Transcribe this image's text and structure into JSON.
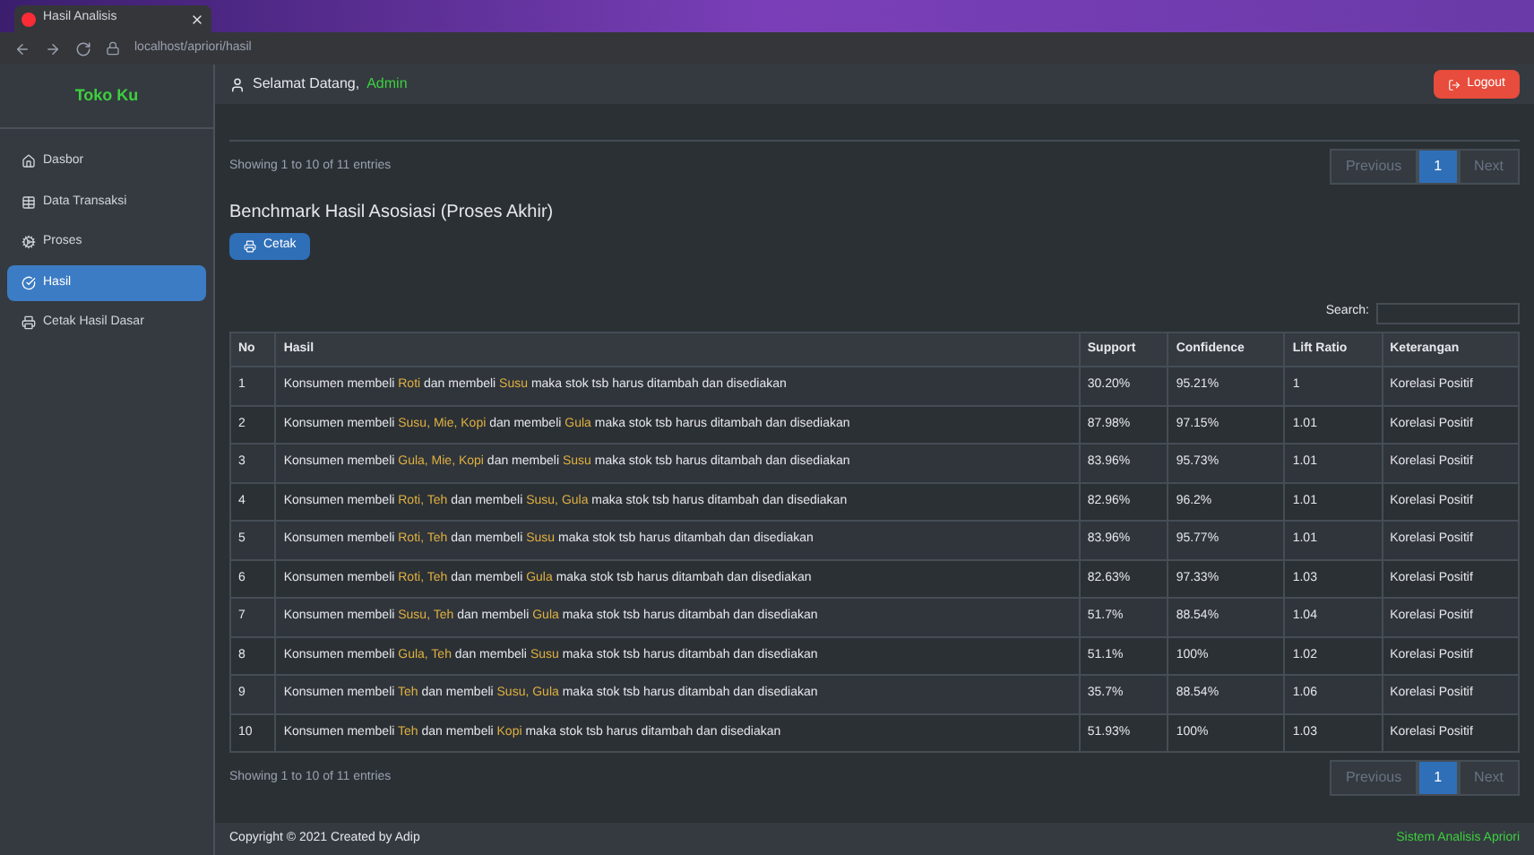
{
  "browser": {
    "tab_title": "Hasil Analisis",
    "address": "localhost/apriori/hasil"
  },
  "sidebar": {
    "logo": "Toko Ku",
    "items": [
      {
        "label": "Dasbor",
        "selected": false
      },
      {
        "label": "Data Transaksi",
        "selected": false
      },
      {
        "label": "Proses",
        "selected": false
      },
      {
        "label": "Hasil",
        "selected": true
      },
      {
        "label": "Cetak Hasil Dasar",
        "selected": false
      }
    ]
  },
  "header": {
    "greeting": "Selamat Datang,",
    "user": "Admin",
    "logout": "Logout"
  },
  "top_info": "Showing 1 to 10 of 11 entries",
  "pagination": [
    {
      "label": "Previous",
      "selected": false
    },
    {
      "label": "1",
      "selected": true
    },
    {
      "label": "Next",
      "selected": false
    }
  ],
  "bottom_pagination": [
    {
      "label": "Previous",
      "selected": false
    },
    {
      "label": "1",
      "selected": true
    },
    {
      "label": "Next",
      "selected": false
    }
  ],
  "section_title": "Benchmark Hasil Asosiasi (Proses Akhir)",
  "print_button": "Cetak",
  "search_label": "Search:",
  "table": {
    "columns": [
      "No",
      "Hasil",
      "Support",
      "Confidence",
      "Lift Ratio",
      "Keterangan"
    ],
    "rows": [
      {
        "no": "1",
        "rule": "Konsumen membeli **Roti** dan membeli **Susu** maka stok tsb harus ditambah dan disediakan",
        "support": "30.20%",
        "confidence": "95.21%",
        "lift": "1",
        "keterangan": "Korelasi Positif"
      },
      {
        "no": "2",
        "rule": "Konsumen membeli **Susu, Mie, Kopi** dan membeli **Gula** maka stok tsb harus ditambah dan disediakan",
        "support": "87.98%",
        "confidence": "97.15%",
        "lift": "1.01",
        "keterangan": "Korelasi Positif"
      },
      {
        "no": "3",
        "rule": "Konsumen membeli **Gula, Mie, Kopi** dan membeli **Susu** maka stok tsb harus ditambah dan disediakan",
        "support": "83.96%",
        "confidence": "95.73%",
        "lift": "1.01",
        "keterangan": "Korelasi Positif"
      },
      {
        "no": "4",
        "rule": "Konsumen membeli **Roti, Teh** dan membeli **Susu, Gula** maka stok tsb harus ditambah dan disediakan",
        "support": "82.96%",
        "confidence": "96.2%",
        "lift": "1.01",
        "keterangan": "Korelasi Positif"
      },
      {
        "no": "5",
        "rule": "Konsumen membeli **Roti, Teh** dan membeli **Susu** maka stok tsb harus ditambah dan disediakan",
        "support": "83.96%",
        "confidence": "95.77%",
        "lift": "1.01",
        "keterangan": "Korelasi Positif"
      },
      {
        "no": "6",
        "rule": "Konsumen membeli **Roti, Teh** dan membeli **Gula** maka stok tsb harus ditambah dan disediakan",
        "support": "82.63%",
        "confidence": "97.33%",
        "lift": "1.03",
        "keterangan": "Korelasi Positif"
      },
      {
        "no": "7",
        "rule": "Konsumen membeli **Susu, Teh** dan membeli **Gula** maka stok tsb harus ditambah dan disediakan",
        "support": "51.7%",
        "confidence": "88.54%",
        "lift": "1.04",
        "keterangan": "Korelasi Positif"
      },
      {
        "no": "8",
        "rule": "Konsumen membeli **Gula, Teh** dan membeli **Susu** maka stok tsb harus ditambah dan disediakan",
        "support": "51.1%",
        "confidence": "100%",
        "lift": "1.02",
        "keterangan": "Korelasi Positif"
      },
      {
        "no": "9",
        "rule": "Konsumen membeli **Teh** dan membeli **Susu, Gula** maka stok tsb harus ditambah dan disediakan",
        "support": "35.7%",
        "confidence": "88.54%",
        "lift": "1.06",
        "keterangan": "Korelasi Positif"
      },
      {
        "no": "10",
        "rule": "Konsumen membeli **Teh** dan membeli **Kopi** maka stok tsb harus ditambah dan disediakan",
        "support": "51.93%",
        "confidence": "100%",
        "lift": "1.03",
        "keterangan": "Korelasi Positif"
      }
    ]
  },
  "bottom_info": "Showing 1 to 10 of 11 entries",
  "footer": {
    "copyright": "Copyright © 2021 Created by Adip",
    "status": "Sistem Analisis Apriori"
  }
}
